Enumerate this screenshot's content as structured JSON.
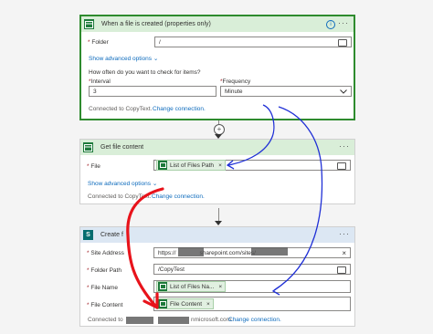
{
  "card1": {
    "title": "When a file is created (properties only)",
    "folder_label": "Folder",
    "folder_value": "/",
    "show_advanced": "Show advanced options",
    "question": "How often do you want to check for items?",
    "interval_label": "Interval",
    "interval_value": "3",
    "frequency_label": "Frequency",
    "frequency_value": "Minute",
    "connected": "Connected to CopyText.",
    "change_connection": "Change connection."
  },
  "card2": {
    "title": "Get file content",
    "file_label": "File",
    "file_chip": "List of Files Path",
    "show_advanced": "Show advanced options",
    "connected": "Connected to CopyText.",
    "change_connection": "Change connection."
  },
  "card3": {
    "title": "Create f",
    "site_label": "Site Address",
    "site_value_a": "https://",
    "site_value_b": "sharepoint.com/sites/",
    "folder_label": "Folder Path",
    "folder_value": "/CopyTest",
    "filename_label": "File Name",
    "filename_chip": "List of Files Na...",
    "content_label": "File Content",
    "content_chip": "File Content",
    "connected_a": "Connected to",
    "connected_b": "nmicrosoft.com.",
    "change_connection": "Change connection."
  },
  "symbols": {
    "required": "*",
    "close": "×",
    "more": "···",
    "info": "i",
    "plus": "+",
    "chevron": "⌄",
    "sp_letter": "S"
  },
  "colors": {
    "accent_green": "#2e8b2e",
    "link_blue": "#0f6cbd",
    "annotation_red": "#e8131b",
    "annotation_blue": "#1f2fd6"
  }
}
